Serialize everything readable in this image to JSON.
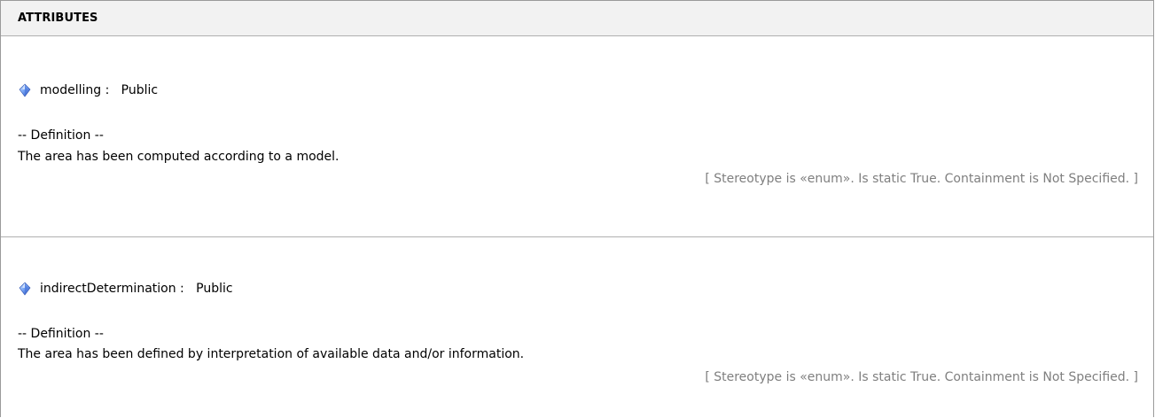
{
  "section": {
    "title": "ATTRIBUTES"
  },
  "attributes": [
    {
      "icon": "attribute-gem-icon",
      "name": "modelling",
      "separator": " :   ",
      "visibility": "Public",
      "definition_label": "-- Definition --",
      "definition": "The area has been computed according to a model.",
      "meta": "[ Stereotype is «enum». Is static True. Containment is Not Specified. ]"
    },
    {
      "icon": "attribute-gem-icon",
      "name": "indirectDetermination",
      "separator": " :   ",
      "visibility": "Public",
      "definition_label": "-- Definition --",
      "definition": "The area has been defined by interpretation of available data and/or information.",
      "meta": "[ Stereotype is «enum». Is static True. Containment is Not Specified. ]"
    }
  ],
  "colors": {
    "header_bg": "#f2f2f2",
    "border": "#9a9a9a",
    "meta_text": "#7f7f7f",
    "gem_light": "#9fc4ff",
    "gem_dark": "#2a55c8"
  }
}
